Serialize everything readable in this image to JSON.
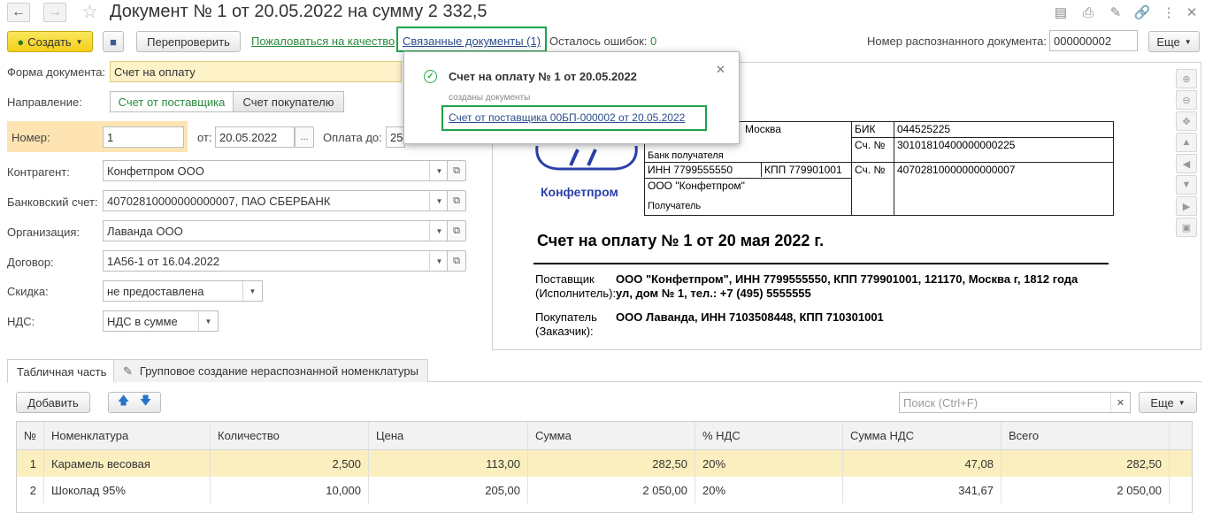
{
  "title": "Документ № 1 от 20.05.2022 на сумму 2 332,5",
  "toolbar": {
    "create": "Создать",
    "recheck": "Перепроверить",
    "complain": "Пожаловаться на качество",
    "related_docs": "Связанные документы (1)",
    "errors_label": "Осталось ошибок:",
    "errors_count": "0",
    "recognized_label": "Номер распознанного документа:",
    "recognized_value": "000000002",
    "more": "Еще"
  },
  "form": {
    "doc_form_label": "Форма документа:",
    "doc_form_value": "Счет на оплату",
    "direction_label": "Направление:",
    "dir_from_supplier": "Счет от поставщика",
    "dir_to_buyer": "Счет покупателю",
    "number_label": "Номер:",
    "number_value": "1",
    "from_label": "от:",
    "date_value": "20.05.2022",
    "pay_until_label": "Оплата до:",
    "pay_until_value": "25",
    "counterparty_label": "Контрагент:",
    "counterparty_value": "Конфетпром ООО",
    "bank_label": "Банковский счет:",
    "bank_value": "40702810000000000007, ПАО СБЕРБАНК",
    "org_label": "Организация:",
    "org_value": "Лаванда ООО",
    "contract_label": "Договор:",
    "contract_value": "1А56-1 от 16.04.2022",
    "discount_label": "Скидка:",
    "discount_value": "не предоставлена",
    "vat_label": "НДС:",
    "vat_value": "НДС в сумме"
  },
  "popup": {
    "title": "Счет на оплату № 1 от 20.05.2022",
    "subtitle": "созданы документы",
    "link": "Счет от поставщика 00БП-000002 от 20.05.2022"
  },
  "preview": {
    "logo_text": "Конфетпром",
    "bank_city": "Москва",
    "bik_label": "БИК",
    "bik_value": "044525225",
    "acc_label": "Сч. №",
    "corr_acc": "30101810400000000225",
    "bank_receiver": "Банк получателя",
    "inn": "ИНН     7799555550",
    "kpp": "КПП  779901001",
    "acc_label2": "Сч. №",
    "acc_value": "40702810000000000007",
    "company": "ООО \"Конфетпром\"",
    "receiver": "Получатель",
    "heading": "Счет на оплату № 1 от 20 мая 2022 г.",
    "supplier_label": "Поставщик (Исполнитель):",
    "supplier_value": "ООО \"Конфетпром\", ИНН 7799555550, КПП 779901001, 121170, Москва г, 1812 года ул, дом № 1, тел.: +7 (495) 5555555",
    "buyer_label": "Покупатель (Заказчик):",
    "buyer_value": "ООО Лаванда, ИНН 7103508448, КПП 710301001"
  },
  "tabs": {
    "table_part": "Табличная часть",
    "group_create": "Групповое создание нераспознанной номенклатуры"
  },
  "table_toolbar": {
    "add": "Добавить",
    "search_placeholder": "Поиск (Ctrl+F)",
    "more": "Еще"
  },
  "table": {
    "columns": [
      "№",
      "Номенклатура",
      "Количество",
      "Цена",
      "Сумма",
      "% НДС",
      "Сумма НДС",
      "Всего"
    ],
    "rows": [
      [
        "1",
        "Карамель весовая",
        "2,500",
        "113,00",
        "282,50",
        "20%",
        "47,08",
        "282,50"
      ],
      [
        "2",
        "Шоколад 95%",
        "10,000",
        "205,00",
        "2 050,00",
        "20%",
        "341,67",
        "2 050,00"
      ]
    ]
  }
}
